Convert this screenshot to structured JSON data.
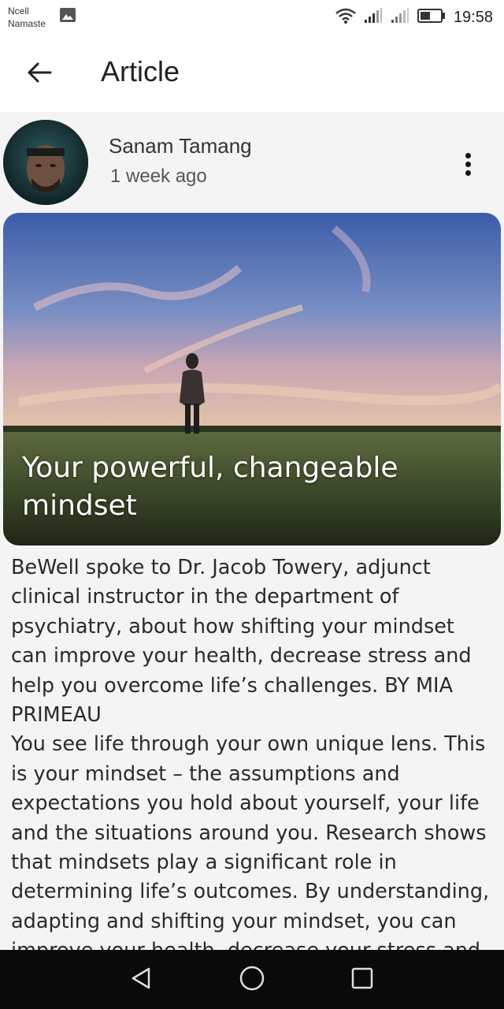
{
  "status_bar": {
    "carrier_line1": "Ncell",
    "carrier_line2": "Namaste",
    "time": "19:58",
    "battery_level": 0.5,
    "icons": [
      "gallery-icon",
      "wifi-icon",
      "signal-icon",
      "signal-icon",
      "battery-icon"
    ]
  },
  "app_bar": {
    "title": "Article",
    "back_icon": "arrow-left-icon"
  },
  "post": {
    "author": "Sanam Tamang",
    "time_ago": "1 week ago",
    "more_icon": "more-vertical-icon",
    "hero_title": "Your powerful, changeable mindset",
    "body": "BeWell spoke to Dr. Jacob Towery, adjunct clinical instructor in the department of psychiatry, about how shifting your mindset can improve your health, decrease stress and help you overcome life’s challenges. BY MIA PRIMEAU\nYou see life through your own unique lens. This is your mindset – the assumptions and expectations you hold about yourself, your life and the situations around you. Research shows that mindsets play a significant role in determining life’s outcomes. By understanding, adapting and shifting your mindset, you can improve your health, decrease your stress and"
  },
  "nav_bar": {
    "icons": [
      "back-triangle-icon",
      "home-circle-icon",
      "recents-square-icon"
    ]
  }
}
